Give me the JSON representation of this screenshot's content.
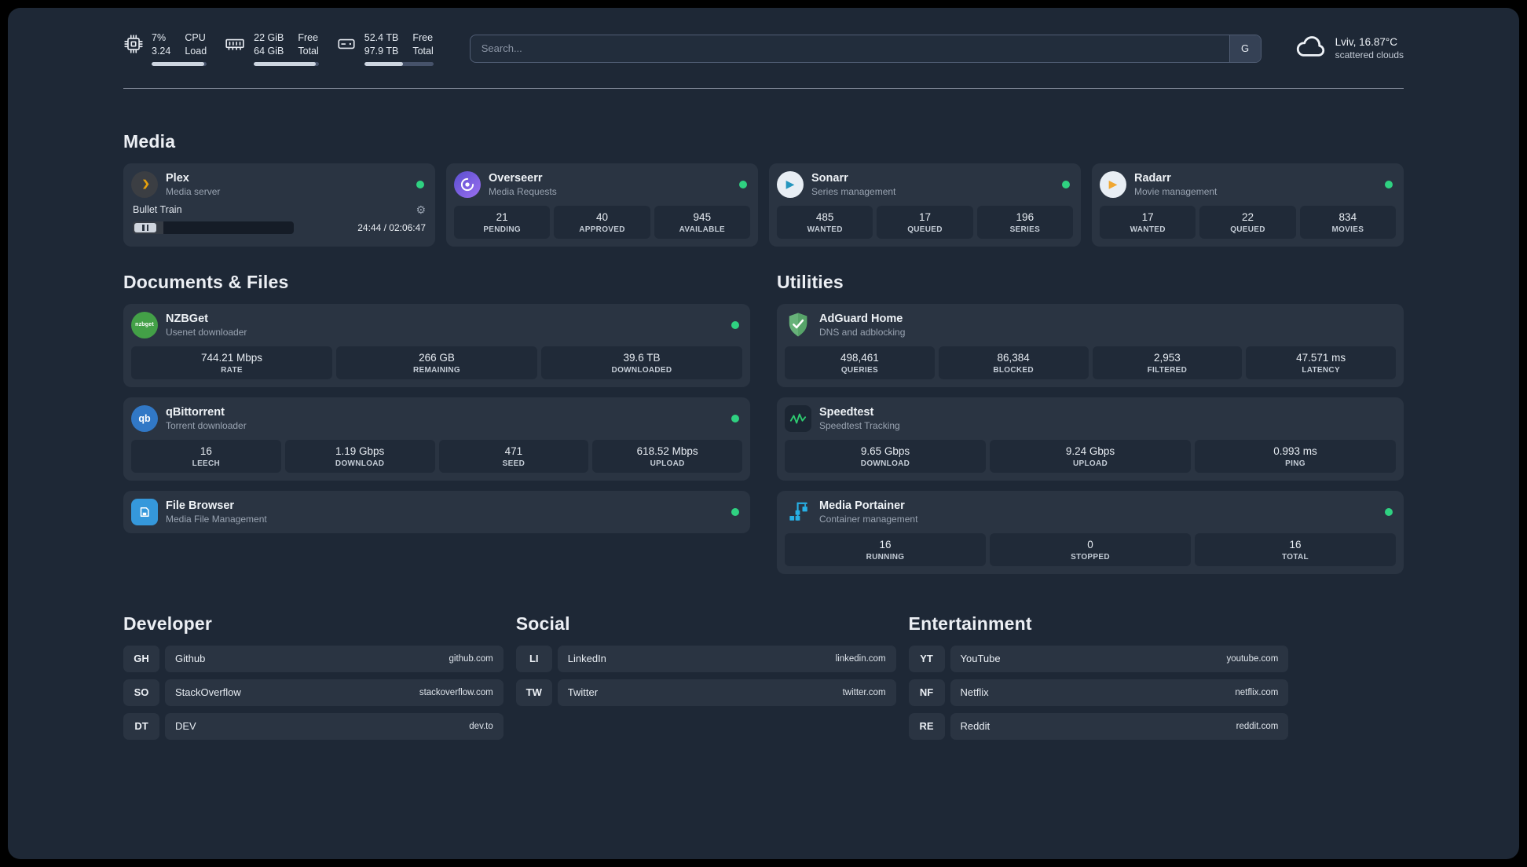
{
  "topbar": {
    "cpu": {
      "percent": "7%",
      "load": "3.24",
      "label_top": "CPU",
      "label_bottom": "Load",
      "progress": 96
    },
    "memory": {
      "free": "22 GiB",
      "total": "64 GiB",
      "label_top": "Free",
      "label_bottom": "Total",
      "progress": 96
    },
    "disk": {
      "free": "52.4 TB",
      "total": "97.9 TB",
      "label_top": "Free",
      "label_bottom": "Total",
      "progress": 56
    },
    "search": {
      "placeholder": "Search...",
      "provider": "G"
    },
    "weather": {
      "location": "Lviv, 16.87°C",
      "condition": "scattered clouds"
    }
  },
  "media": {
    "title": "Media",
    "plex": {
      "name": "Plex",
      "subtitle": "Media server",
      "now_playing": "Bullet Train",
      "time": "24:44 / 02:06:47",
      "progress": 19
    },
    "overseerr": {
      "name": "Overseerr",
      "subtitle": "Media Requests",
      "stats": [
        {
          "value": "21",
          "label": "PENDING"
        },
        {
          "value": "40",
          "label": "APPROVED"
        },
        {
          "value": "945",
          "label": "AVAILABLE"
        }
      ]
    },
    "sonarr": {
      "name": "Sonarr",
      "subtitle": "Series management",
      "stats": [
        {
          "value": "485",
          "label": "WANTED"
        },
        {
          "value": "17",
          "label": "QUEUED"
        },
        {
          "value": "196",
          "label": "SERIES"
        }
      ]
    },
    "radarr": {
      "name": "Radarr",
      "subtitle": "Movie management",
      "stats": [
        {
          "value": "17",
          "label": "WANTED"
        },
        {
          "value": "22",
          "label": "QUEUED"
        },
        {
          "value": "834",
          "label": "MOVIES"
        }
      ]
    }
  },
  "documents": {
    "title": "Documents & Files",
    "nzbget": {
      "name": "NZBGet",
      "subtitle": "Usenet downloader",
      "stats": [
        {
          "value": "744.21 Mbps",
          "label": "RATE"
        },
        {
          "value": "266 GB",
          "label": "REMAINING"
        },
        {
          "value": "39.6 TB",
          "label": "DOWNLOADED"
        }
      ]
    },
    "qbittorrent": {
      "name": "qBittorrent",
      "subtitle": "Torrent downloader",
      "stats": [
        {
          "value": "16",
          "label": "LEECH"
        },
        {
          "value": "1.19 Gbps",
          "label": "DOWNLOAD"
        },
        {
          "value": "471",
          "label": "SEED"
        },
        {
          "value": "618.52 Mbps",
          "label": "UPLOAD"
        }
      ]
    },
    "filebrowser": {
      "name": "File Browser",
      "subtitle": "Media File Management"
    }
  },
  "utilities": {
    "title": "Utilities",
    "adguard": {
      "name": "AdGuard Home",
      "subtitle": "DNS and adblocking",
      "stats": [
        {
          "value": "498,461",
          "label": "QUERIES"
        },
        {
          "value": "86,384",
          "label": "BLOCKED"
        },
        {
          "value": "2,953",
          "label": "FILTERED"
        },
        {
          "value": "47.571 ms",
          "label": "LATENCY"
        }
      ]
    },
    "speedtest": {
      "name": "Speedtest",
      "subtitle": "Speedtest Tracking",
      "stats": [
        {
          "value": "9.65 Gbps",
          "label": "DOWNLOAD"
        },
        {
          "value": "9.24 Gbps",
          "label": "UPLOAD"
        },
        {
          "value": "0.993 ms",
          "label": "PING"
        }
      ]
    },
    "portainer": {
      "name": "Media Portainer",
      "subtitle": "Container management",
      "stats": [
        {
          "value": "16",
          "label": "RUNNING"
        },
        {
          "value": "0",
          "label": "STOPPED"
        },
        {
          "value": "16",
          "label": "TOTAL"
        }
      ]
    }
  },
  "bookmarks": [
    {
      "title": "Developer",
      "items": [
        {
          "abbr": "GH",
          "name": "Github",
          "url": "github.com"
        },
        {
          "abbr": "SO",
          "name": "StackOverflow",
          "url": "stackoverflow.com"
        },
        {
          "abbr": "DT",
          "name": "DEV",
          "url": "dev.to"
        }
      ]
    },
    {
      "title": "Social",
      "items": [
        {
          "abbr": "LI",
          "name": "LinkedIn",
          "url": "linkedin.com"
        },
        {
          "abbr": "TW",
          "name": "Twitter",
          "url": "twitter.com"
        }
      ]
    },
    {
      "title": "Entertainment",
      "items": [
        {
          "abbr": "YT",
          "name": "YouTube",
          "url": "youtube.com"
        },
        {
          "abbr": "NF",
          "name": "Netflix",
          "url": "netflix.com"
        },
        {
          "abbr": "RE",
          "name": "Reddit",
          "url": "reddit.com"
        }
      ]
    }
  ],
  "icons": {
    "gear": "⚙",
    "play": "▶",
    "nzbget_text": "nzbget",
    "qb_text": "qb"
  },
  "colors": {
    "status_ok": "#2fd181",
    "plex_amber": "#e5a00d",
    "background": "#1e2836",
    "card": "#2a3442"
  }
}
